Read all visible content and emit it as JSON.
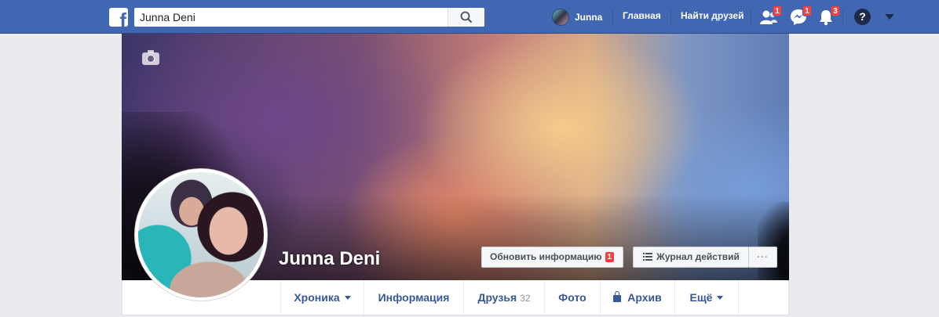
{
  "topbar": {
    "logo_letter": "f",
    "search_value": "Junna Deni",
    "user_name": "Junna",
    "home_label": "Главная",
    "find_friends_label": "Найти друзей",
    "friend_requests_badge": "1",
    "messages_badge": "1",
    "notifications_badge": "3",
    "help_label": "?"
  },
  "profile": {
    "name": "Junna Deni",
    "update_info_label": "Обновить информацию",
    "update_info_badge": "1",
    "activity_log_label": "Журнал действий",
    "more_label": "···"
  },
  "tabs": {
    "timeline": "Хроника",
    "about": "Информация",
    "friends": "Друзья",
    "friends_count": "32",
    "photos": "Фото",
    "archive": "Архив",
    "more": "Ещё"
  },
  "colors": {
    "brand_blue": "#4267b2",
    "link_blue": "#365899",
    "badge_red": "#fa3e3e",
    "page_bg": "#e9ebee"
  }
}
